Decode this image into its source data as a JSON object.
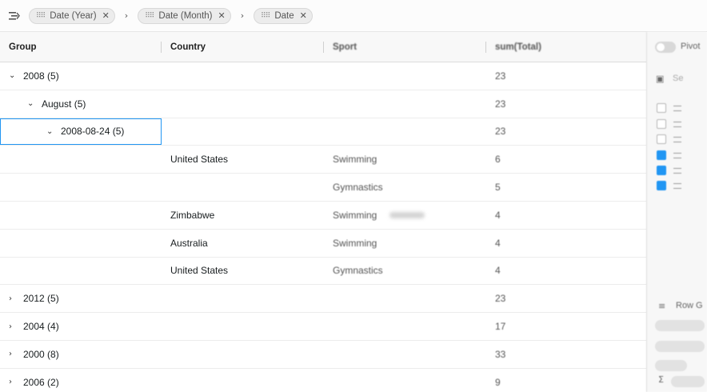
{
  "group_panel": {
    "icon": "row-group-icon",
    "chips": [
      {
        "label": "Date (Year)"
      },
      {
        "label": "Date (Month)"
      },
      {
        "label": "Date"
      }
    ],
    "separator": "›",
    "remove_icon": "✕"
  },
  "columns": {
    "group": "Group",
    "country": "Country",
    "sport": "Sport",
    "total": "sum(Total)"
  },
  "rows": [
    {
      "type": "group",
      "level": 0,
      "expanded": true,
      "label": "2008 (5)",
      "total": "23"
    },
    {
      "type": "group",
      "level": 1,
      "expanded": true,
      "label": "August (5)",
      "total": "23"
    },
    {
      "type": "group",
      "level": 2,
      "expanded": true,
      "label": "2008-08-24 (5)",
      "total": "23"
    },
    {
      "type": "leaf",
      "country": "United States",
      "sport": "Swimming",
      "total": "6"
    },
    {
      "type": "leaf",
      "country": "",
      "sport": "Gymnastics",
      "total": "5"
    },
    {
      "type": "leaf",
      "country": "Zimbabwe",
      "sport": "Swimming",
      "total": "4"
    },
    {
      "type": "leaf",
      "country": "Australia",
      "sport": "Swimming",
      "total": "4"
    },
    {
      "type": "leaf",
      "country": "United States",
      "sport": "Gymnastics",
      "total": "4"
    },
    {
      "type": "group",
      "level": 0,
      "expanded": false,
      "label": "2012 (5)",
      "total": "23"
    },
    {
      "type": "group",
      "level": 0,
      "expanded": false,
      "label": "2004 (4)",
      "total": "17"
    },
    {
      "type": "group",
      "level": 0,
      "expanded": false,
      "label": "2000 (8)",
      "total": "33"
    },
    {
      "type": "group",
      "level": 0,
      "expanded": false,
      "label": "2006 (2)",
      "total": "9"
    }
  ],
  "icons": {
    "expanded": "⌄",
    "collapsed": "›"
  },
  "tool_panel": {
    "pivot_label": "Pivot",
    "search_placeholder": "Se",
    "column_checks": [
      false,
      false,
      false,
      true,
      true,
      true
    ],
    "row_groups_label": "Row G"
  },
  "colors": {
    "accent": "#2196f3",
    "header_bg": "#f8f8f8",
    "row_border": "#ececec"
  }
}
